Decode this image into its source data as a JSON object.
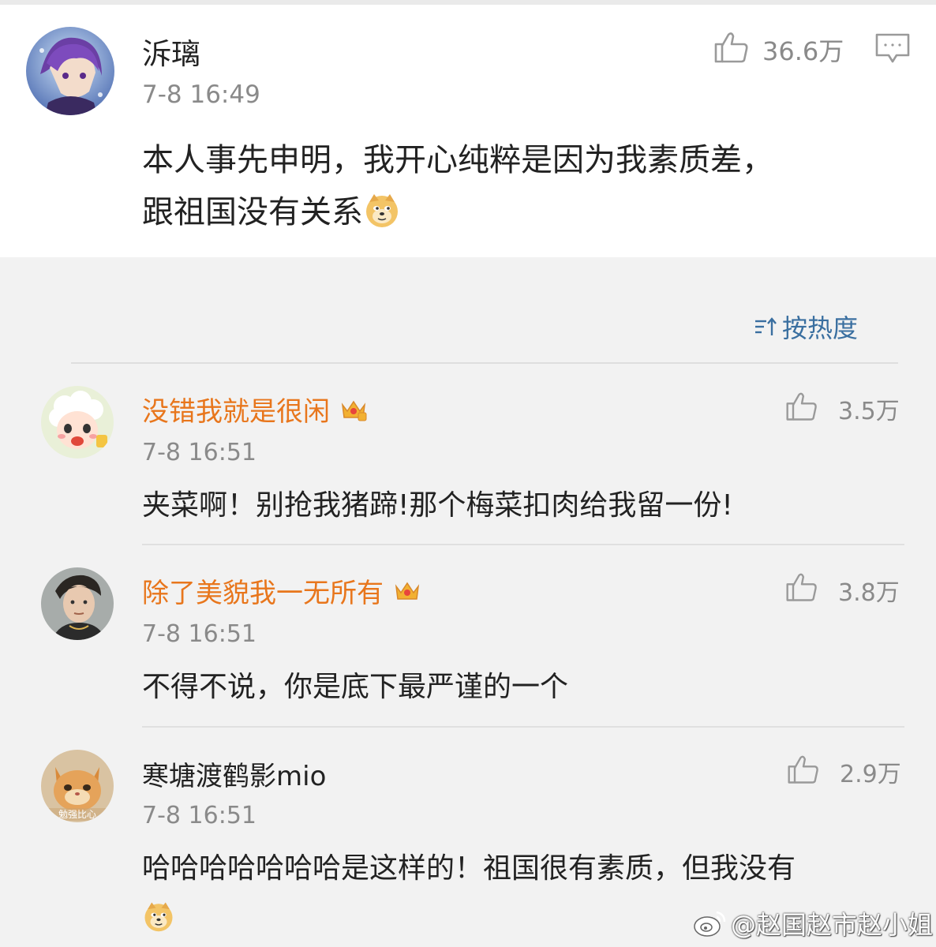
{
  "main_post": {
    "username": "泝璃",
    "time": "7-8 16:49",
    "like_count": "36.6万",
    "text_line1": "本人事先申明，我开心纯粹是因为我素质差，",
    "text_line2": "跟祖国没有关系"
  },
  "sort": {
    "label": "按热度",
    "icon": "sort-icon"
  },
  "comments": [
    {
      "username": "没错我就是很闲",
      "vip": true,
      "time": "7-8 16:51",
      "like_count": "3.5万",
      "text": "夹菜啊！别抢我猪蹄!那个梅菜扣肉给我留一份!"
    },
    {
      "username": "除了美貌我一无所有",
      "vip": true,
      "time": "7-8 16:51",
      "like_count": "3.8万",
      "text": "不得不说，你是底下最严谨的一个"
    },
    {
      "username": "寒塘渡鹤影mio",
      "vip": false,
      "time": "7-8 16:51",
      "like_count": "2.9万",
      "text": "哈哈哈哈哈哈哈是这样的！祖国很有素质，但我没有",
      "avatar_caption": "勉强比心"
    }
  ],
  "watermark": {
    "text": "@赵国赵市赵小姐"
  },
  "colors": {
    "vip_name": "#e8761c",
    "sort_label": "#3a6fa0",
    "meta_gray": "#8a8a8a"
  }
}
